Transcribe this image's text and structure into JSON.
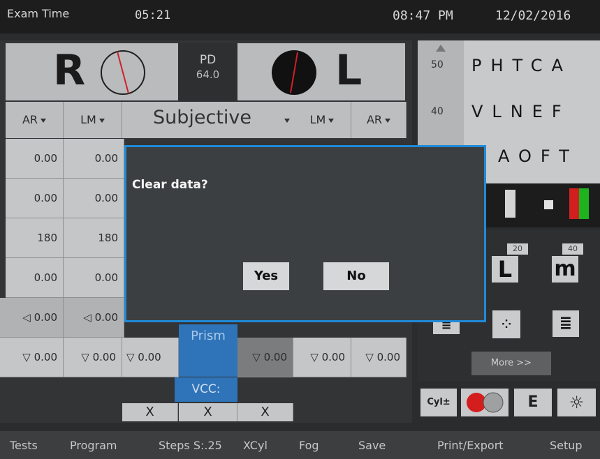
{
  "header": {
    "exam_label": "Exam Time",
    "exam_timer": "05:21",
    "clock": "08:47 PM",
    "date": "12/02/2016"
  },
  "eyes": {
    "right_label": "R",
    "left_label": "L",
    "pd_label": "PD",
    "pd_value": "64.0"
  },
  "columns": {
    "ar_left": "AR",
    "lm_left": "LM",
    "subjective": "Subjective",
    "lm_right": "LM",
    "ar_right": "AR"
  },
  "rows": {
    "sph": [
      "0.00",
      "0.00"
    ],
    "cyl": [
      "0.00",
      "0.00"
    ],
    "axis": [
      "180",
      "180"
    ],
    "add": [
      "0.00",
      "0.00"
    ],
    "prism_h": [
      "◁ 0.00",
      "◁ 0.00"
    ],
    "prism_v": [
      "▽ 0.00",
      "▽ 0.00",
      "▽ 0.00",
      "▽ 0.00",
      "▽ 0.00",
      "▽ 0.00"
    ]
  },
  "prism_label": "Prism",
  "vcc_label": "VCC:",
  "x_marks": [
    "X",
    "X",
    "X"
  ],
  "chart": {
    "sizes": [
      "50",
      "40"
    ],
    "lines": [
      "PHTCA",
      "VLNEF",
      "AOFT"
    ]
  },
  "tests": {
    "tag1": "20",
    "tag2": "40",
    "more": "More >>"
  },
  "bottom_menu": [
    "Tests",
    "Program",
    "Steps S:.25",
    "XCyl",
    "Fog",
    "Save",
    "Print/Export",
    "Setup"
  ],
  "dialog": {
    "message": "Clear data?",
    "yes": "Yes",
    "no": "No"
  },
  "colors": {
    "accent": "#2f73b8",
    "dialog_border": "#1f8ad8"
  }
}
